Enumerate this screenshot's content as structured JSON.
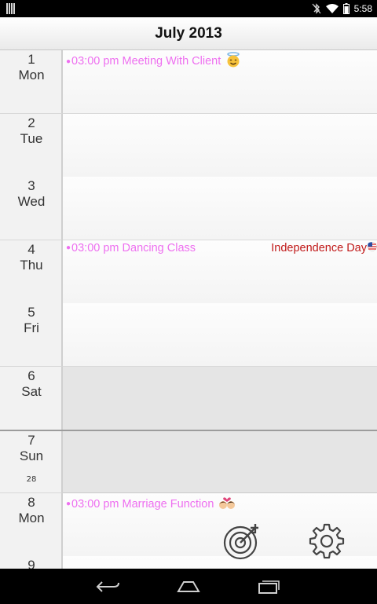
{
  "status_bar": {
    "time": "5:58"
  },
  "header": {
    "title": "July 2013"
  },
  "days": [
    {
      "num": "1",
      "name": "Mon",
      "weekend": false,
      "events": [
        {
          "text": "03:00 pm Meeting With Client",
          "icon": "angel-face-icon"
        }
      ]
    },
    {
      "num": "2",
      "name": "Tue",
      "weekend": false,
      "events": []
    },
    {
      "num": "3",
      "name": "Wed",
      "weekend": false,
      "events": []
    },
    {
      "num": "4",
      "name": "Thu",
      "weekend": false,
      "events": [
        {
          "text": "03:00 pm Dancing Class"
        }
      ],
      "holiday": {
        "text": "Independence Day",
        "icon": "us-flag-icon"
      }
    },
    {
      "num": "5",
      "name": "Fri",
      "weekend": false,
      "events": []
    },
    {
      "num": "6",
      "name": "Sat",
      "weekend": true,
      "events": []
    },
    {
      "num": "7",
      "name": "Sun",
      "weekend": true,
      "week_number": "28",
      "events": []
    },
    {
      "num": "8",
      "name": "Mon",
      "weekend": false,
      "events": [
        {
          "text": "03:00 pm Marriage Function",
          "icon": "couple-heart-icon"
        }
      ]
    },
    {
      "num": "9",
      "name": "",
      "weekend": false,
      "events": []
    }
  ],
  "colors": {
    "event_text": "#ee6ff0",
    "holiday_text": "#c01818",
    "weekend_bg": "#e5e5e5"
  },
  "actions": {
    "today_icon": "target-icon",
    "settings_icon": "gear-icon"
  },
  "nav": {
    "back_icon": "back-icon",
    "home_icon": "home-icon",
    "recents_icon": "recents-icon"
  }
}
